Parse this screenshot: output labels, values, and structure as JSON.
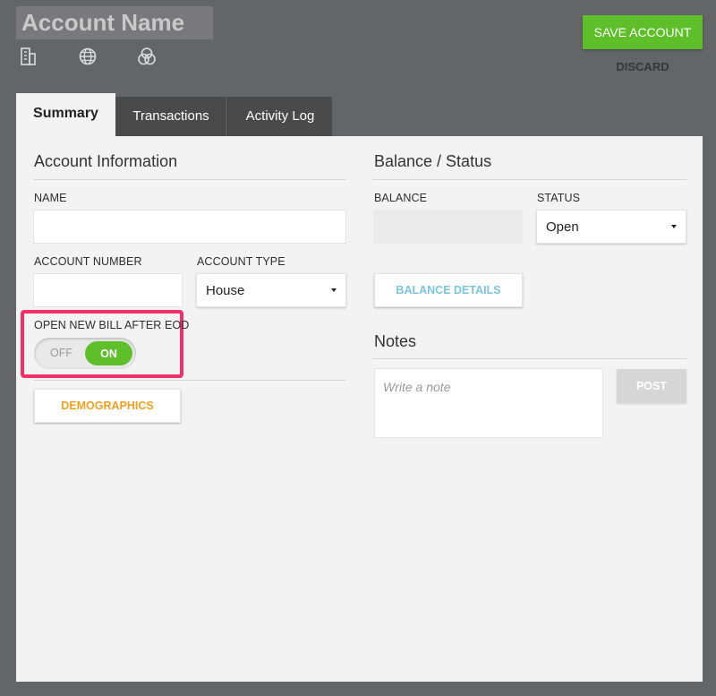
{
  "header": {
    "account_name": "Account Name",
    "icons": [
      "building-icon",
      "globe-icon",
      "circles-icon"
    ],
    "save_label": "SAVE ACCOUNT",
    "discard_label": "DISCARD"
  },
  "tabs": [
    {
      "label": "Summary",
      "active": true
    },
    {
      "label": "Transactions",
      "active": false
    },
    {
      "label": "Activity Log",
      "active": false
    }
  ],
  "account_info": {
    "heading": "Account Information",
    "name_label": "NAME",
    "name_value": "",
    "account_number_label": "ACCOUNT NUMBER",
    "account_number_value": "",
    "account_type_label": "ACCOUNT TYPE",
    "account_type_value": "House",
    "eod_label": "OPEN NEW BILL AFTER EOD",
    "toggle_off": "OFF",
    "toggle_on": "ON",
    "toggle_state": "on",
    "demographics_label": "DEMOGRAPHICS"
  },
  "balance_status": {
    "heading": "Balance / Status",
    "balance_label": "BALANCE",
    "balance_value": "",
    "status_label": "STATUS",
    "status_value": "Open",
    "balance_details_label": "BALANCE DETAILS"
  },
  "notes": {
    "heading": "Notes",
    "placeholder": "Write a note",
    "post_label": "POST"
  },
  "colors": {
    "background": "#646567",
    "panel": "#f3f3f3",
    "accent_green": "#5fbf2a",
    "highlight_pink": "#f0306a",
    "demographics_orange": "#f0a020",
    "balance_details_blue": "#7ec3dd"
  }
}
